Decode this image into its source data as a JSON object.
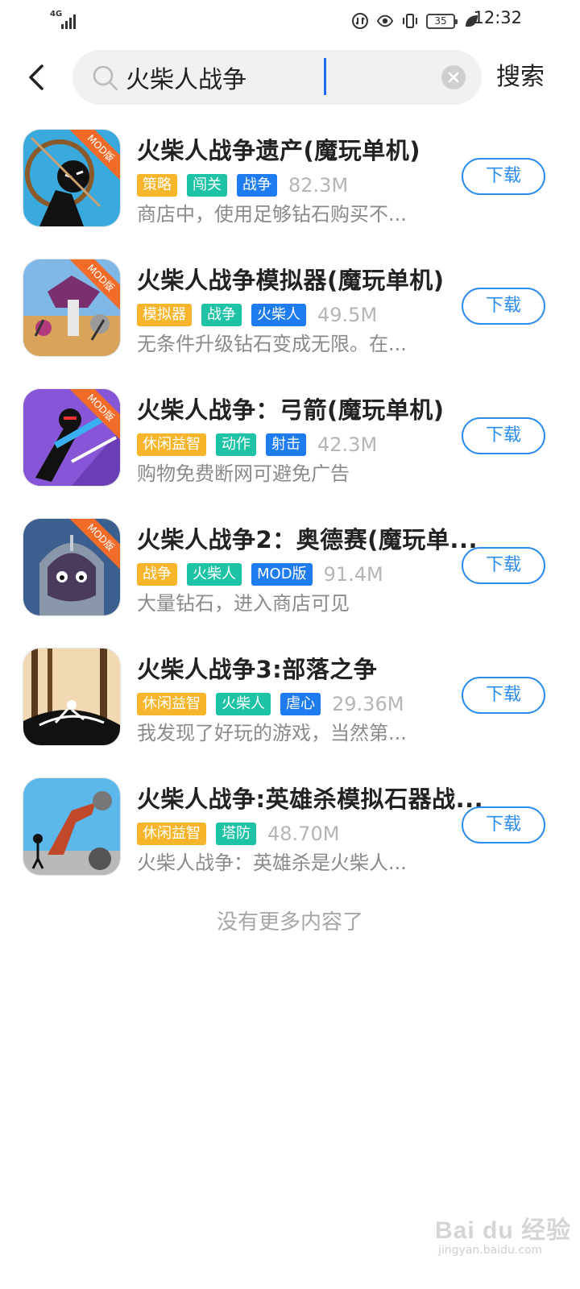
{
  "status_bar": {
    "network": "4G",
    "battery": "35",
    "time": "12:32"
  },
  "search": {
    "query": "火柴人战争",
    "search_button": "搜索"
  },
  "results": [
    {
      "title": "火柴人战争遗产(魔玩单机)",
      "badge": "MOD版",
      "tags": [
        {
          "label": "策略",
          "color": "#f7b52c"
        },
        {
          "label": "闯关",
          "color": "#1ec2a4"
        },
        {
          "label": "战争",
          "color": "#1f7cf0"
        }
      ],
      "size": "82.3M",
      "desc": "商店中，使用足够钻石购买不...",
      "download": "下载"
    },
    {
      "title": "火柴人战争模拟器(魔玩单机)",
      "badge": "MOD版",
      "tags": [
        {
          "label": "模拟器",
          "color": "#f7b52c"
        },
        {
          "label": "战争",
          "color": "#1ec2a4"
        },
        {
          "label": "火柴人",
          "color": "#1f7cf0"
        }
      ],
      "size": "49.5M",
      "desc": "无条件升级钻石变成无限。在...",
      "download": "下载"
    },
    {
      "title": "火柴人战争：弓箭(魔玩单机)",
      "badge": "MOD版",
      "tags": [
        {
          "label": "休闲益智",
          "color": "#f7b52c"
        },
        {
          "label": "动作",
          "color": "#1ec2a4"
        },
        {
          "label": "射击",
          "color": "#1f7cf0"
        }
      ],
      "size": "42.3M",
      "desc": "购物免费断网可避免广告",
      "download": "下载"
    },
    {
      "title": "火柴人战争2：奥德赛(魔玩单...",
      "badge": "MOD版",
      "tags": [
        {
          "label": "战争",
          "color": "#f7b52c"
        },
        {
          "label": "火柴人",
          "color": "#1ec2a4"
        },
        {
          "label": "MOD版",
          "color": "#1f7cf0"
        }
      ],
      "size": "91.4M",
      "desc": "大量钻石，进入商店可见",
      "download": "下载"
    },
    {
      "title": "火柴人战争3:部落之争",
      "badge": "",
      "tags": [
        {
          "label": "休闲益智",
          "color": "#f7b52c"
        },
        {
          "label": "火柴人",
          "color": "#1ec2a4"
        },
        {
          "label": "虐心",
          "color": "#1f7cf0"
        }
      ],
      "size": "29.36M",
      "desc": "我发现了好玩的游戏，当然第...",
      "download": "下载"
    },
    {
      "title": "火柴人战争:英雄杀模拟石器战...",
      "badge": "",
      "tags": [
        {
          "label": "休闲益智",
          "color": "#f7b52c"
        },
        {
          "label": "塔防",
          "color": "#1ec2a4"
        }
      ],
      "size": "48.70M",
      "desc": "火柴人战争：英雄杀是火柴人...",
      "download": "下载"
    }
  ],
  "end_message": "没有更多内容了",
  "watermark": {
    "main": "Bai du 经验",
    "sub": "jingyan.baidu.com"
  }
}
